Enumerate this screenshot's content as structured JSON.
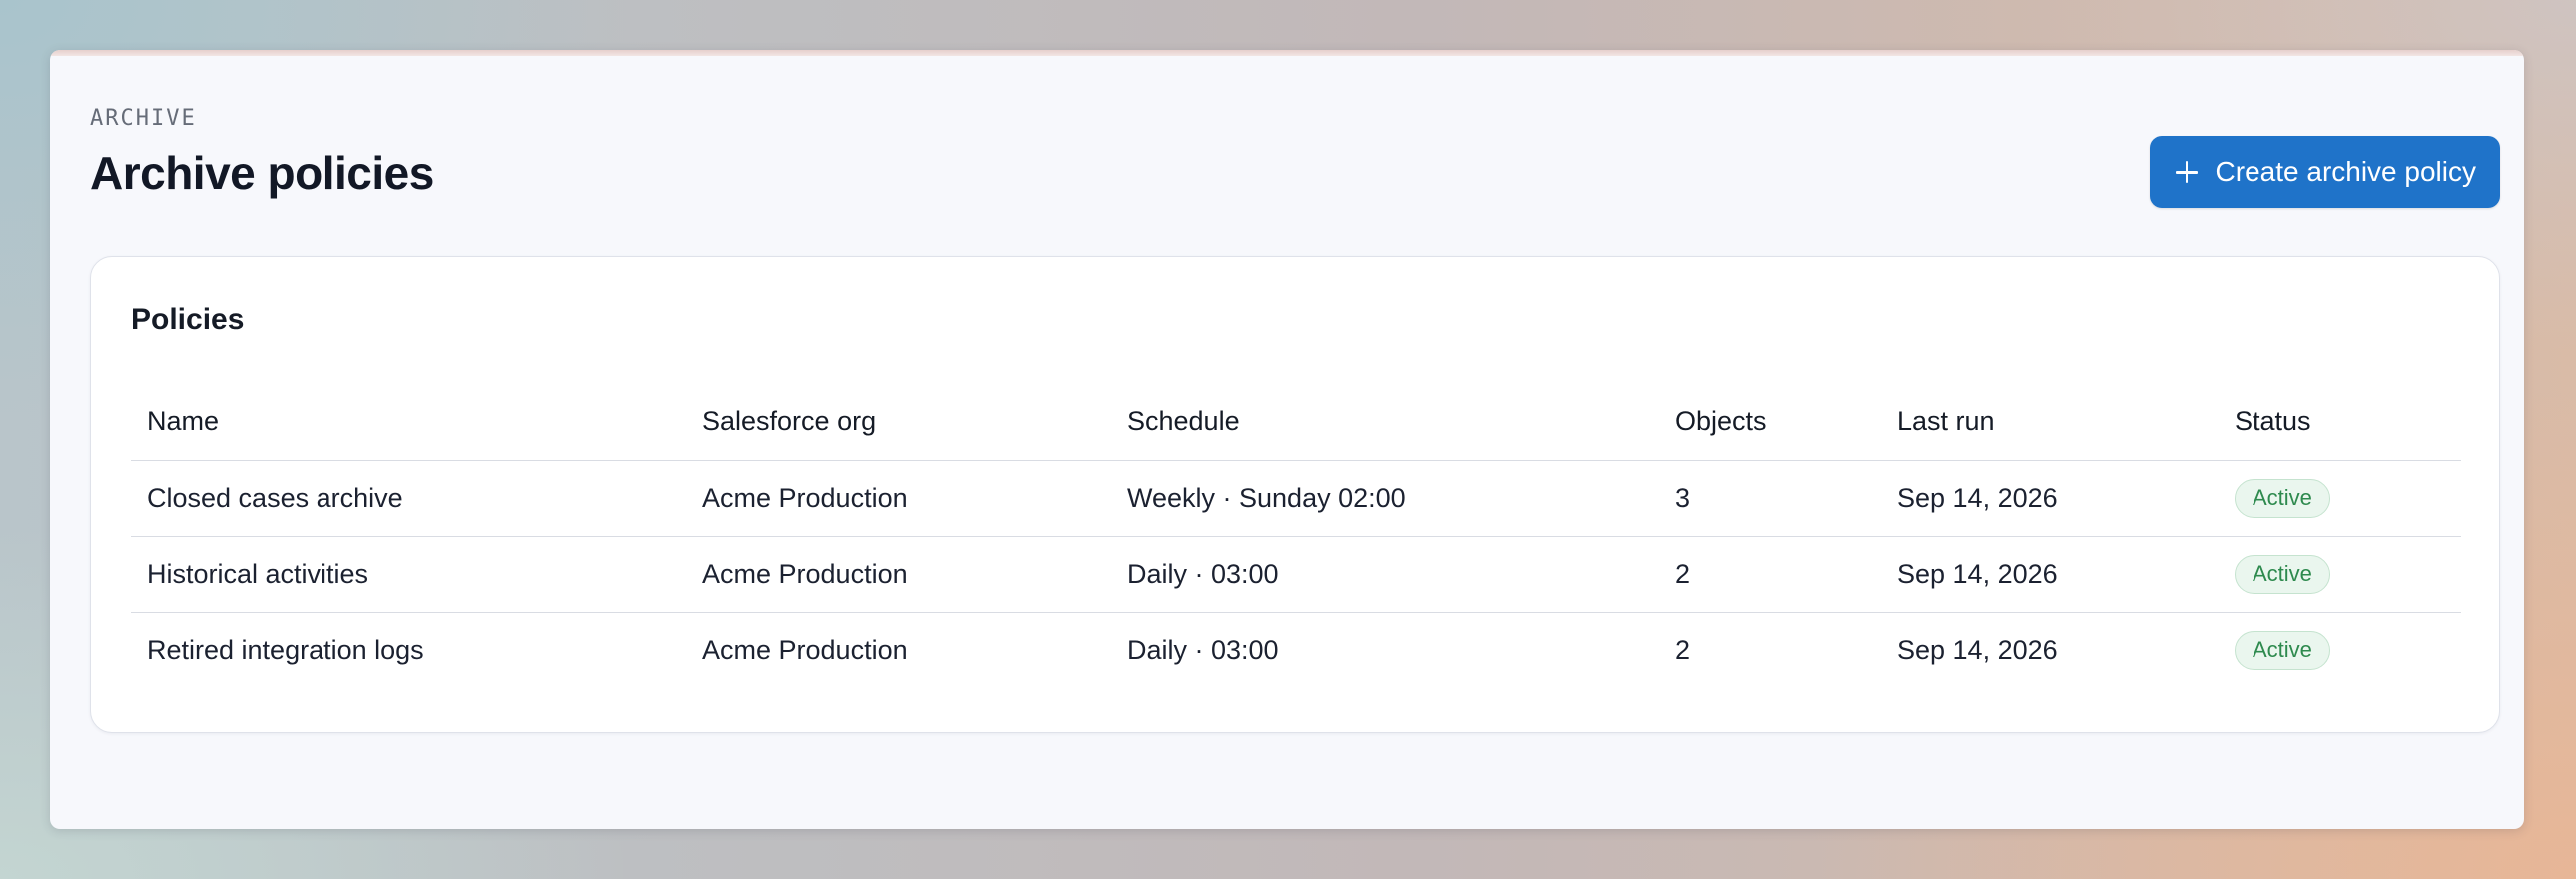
{
  "header": {
    "eyebrow": "ARCHIVE",
    "title": "Archive policies",
    "create_button_label": "Create archive policy",
    "create_button_icon": "plus-icon"
  },
  "policies_card": {
    "title": "Policies",
    "columns": [
      "Name",
      "Salesforce org",
      "Schedule",
      "Objects",
      "Last run",
      "Status"
    ],
    "rows": [
      {
        "name": "Closed cases archive",
        "org": "Acme Production",
        "schedule": "Weekly · Sunday 02:00",
        "objects": "3",
        "last_run": "Sep 14, 2026",
        "status": "Active"
      },
      {
        "name": "Historical activities",
        "org": "Acme Production",
        "schedule": "Daily · 03:00",
        "objects": "2",
        "last_run": "Sep 14, 2026",
        "status": "Active"
      },
      {
        "name": "Retired integration logs",
        "org": "Acme Production",
        "schedule": "Daily · 03:00",
        "objects": "2",
        "last_run": "Sep 14, 2026",
        "status": "Active"
      }
    ]
  },
  "colors": {
    "accent": "#1f73c9",
    "status_active_text": "#2e8a4e",
    "status_active_bg": "#eaf6ee"
  }
}
